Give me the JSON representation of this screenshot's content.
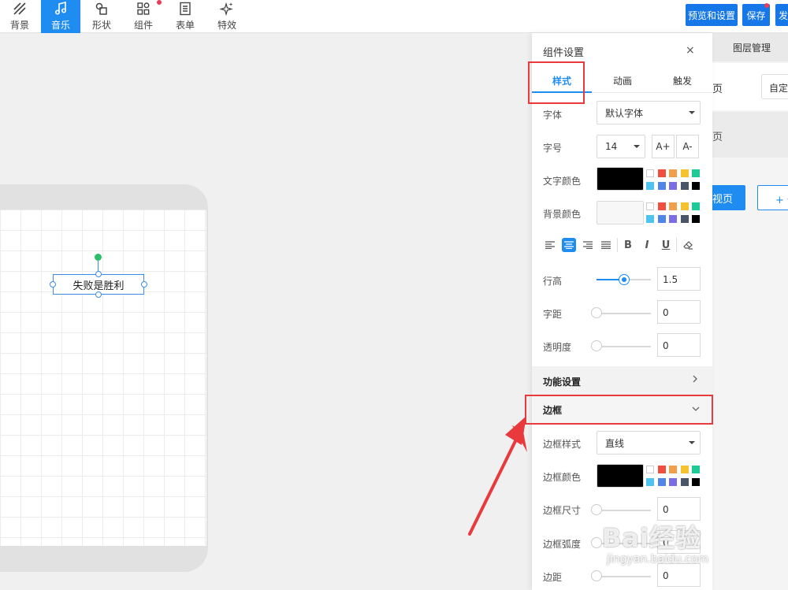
{
  "toolbar": {
    "items": [
      {
        "label": "背景",
        "icon": "background-pattern-icon"
      },
      {
        "label": "音乐",
        "icon": "music-note-icon"
      },
      {
        "label": "形状",
        "icon": "shape-icon"
      },
      {
        "label": "组件",
        "icon": "component-grid-icon"
      },
      {
        "label": "表单",
        "icon": "form-icon"
      },
      {
        "label": "特效",
        "icon": "sparkle-icon"
      }
    ],
    "preview_button": "预览和设置",
    "save_button": "保存",
    "publish_button": "发"
  },
  "canvas": {
    "text_element": "失败是胜利"
  },
  "right_panel": {
    "layer_tab": "图层管理",
    "page_label": "页",
    "custom_select": "自定义",
    "page_label_2": "页",
    "primary_button": "视页",
    "add_button": "+ 也"
  },
  "settings": {
    "title": "组件设置",
    "close": "×",
    "tabs": [
      "样式",
      "动画",
      "触发"
    ],
    "font_label": "字体",
    "font_value": "默认字体",
    "size_label": "字号",
    "size_value": "14",
    "size_up": "A+",
    "size_down": "A-",
    "text_color_label": "文字颜色",
    "bg_color_label": "背景颜色",
    "text_color_value": "#000000",
    "bg_color_value": "#f7f7f7",
    "palette": [
      "#ffffff",
      "#f04e3e",
      "#f0a04b",
      "#f5c330",
      "#1ec99a",
      "#4fc3f0",
      "#4f86e8",
      "#7a6de6",
      "#4b5568",
      "#000000"
    ],
    "format_buttons": [
      "B",
      "I",
      "U"
    ],
    "line_height_label": "行高",
    "line_height_value": "1.5",
    "line_height_level": 0.5,
    "letter_spacing_label": "字距",
    "letter_spacing_value": "0",
    "opacity_label": "透明度",
    "opacity_value": "0",
    "function_section": "功能设置",
    "border_section": "边框",
    "border_style_label": "边框样式",
    "border_style_value": "直线",
    "border_color_label": "边框颜色",
    "border_color_value": "#000000",
    "border_size_label": "边框尺寸",
    "border_size_value": "0",
    "border_radius_label": "边框弧度",
    "border_radius_value": "0",
    "padding_label": "边距",
    "padding_value": "0"
  },
  "watermark": {
    "logo": "Bai经验",
    "url": "jingyan.baidu.com"
  },
  "accent_color": "#1e8cf0",
  "annotation_color": "#e8393d"
}
